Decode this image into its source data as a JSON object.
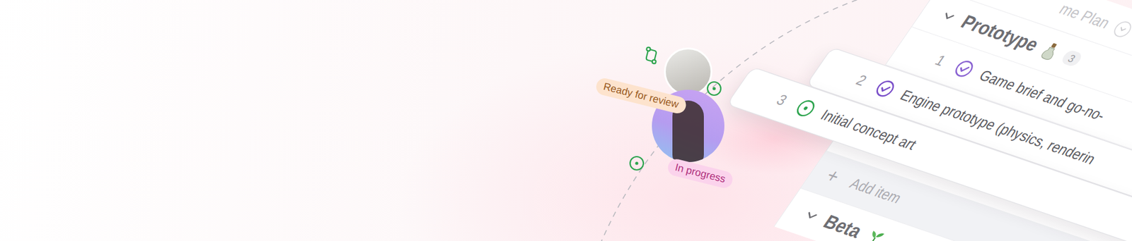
{
  "plan": {
    "title": "me Plan"
  },
  "groups": [
    {
      "title": "Prototype",
      "count": "3",
      "expanded": true,
      "items": [
        {
          "number": "1",
          "title": "Game brief and go-no-",
          "status": "done",
          "color": "#8a63d2",
          "lifted": false
        },
        {
          "number": "2",
          "title": "Engine prototype (physics, renderin",
          "status": "done",
          "color": "#7a4fc9",
          "lifted": true
        },
        {
          "number": "3",
          "title": "Initial concept art",
          "status": "open",
          "color": "#2da44e",
          "lifted": true
        }
      ]
    },
    {
      "title": "Beta",
      "expanded": true,
      "items": []
    }
  ],
  "add_item": {
    "icon": "+",
    "label": "Add item"
  },
  "avatars": [
    {
      "badge": "Ready for review",
      "color": "#fde3cd"
    },
    {
      "badge": "In progress",
      "color": "#fbd3ec"
    }
  ]
}
